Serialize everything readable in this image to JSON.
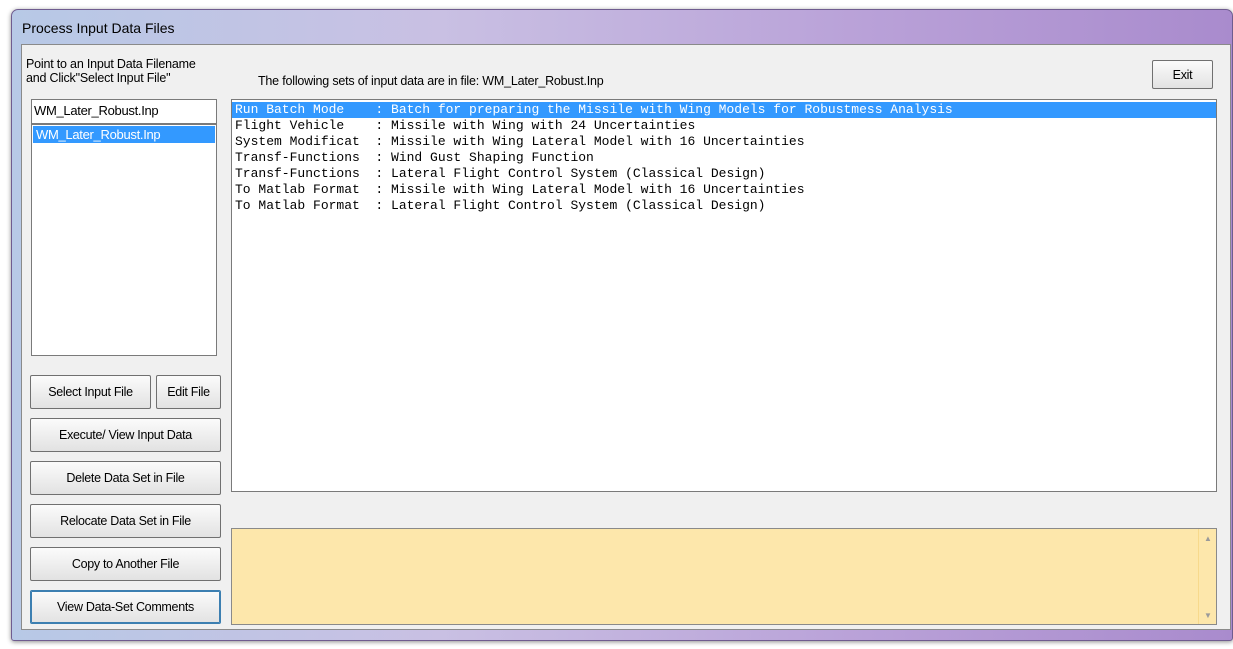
{
  "window": {
    "title": "Process Input Data Files"
  },
  "instructions": {
    "line1": "Point to an Input Data Filename",
    "line2": "and Click\"Select Input File\""
  },
  "file_header": {
    "text": "The following sets of input data are in file: WM_Later_Robust.Inp"
  },
  "exit_label": "Exit",
  "filename_field": {
    "value": "WM_Later_Robust.Inp"
  },
  "file_list": [
    "WM_Later_Robust.Inp"
  ],
  "datasets": [
    {
      "text": "Run Batch Mode    : Batch for preparing the Missile with Wing Models for Robustmess Analysis",
      "selected": true
    },
    {
      "text": "Flight Vehicle    : Missile with Wing with 24 Uncertainties",
      "selected": false
    },
    {
      "text": "System Modificat  : Missile with Wing Lateral Model with 16 Uncertainties",
      "selected": false
    },
    {
      "text": "Transf-Functions  : Wind Gust Shaping Function",
      "selected": false
    },
    {
      "text": "Transf-Functions  : Lateral Flight Control System (Classical Design)",
      "selected": false
    },
    {
      "text": "To Matlab Format  : Missile with Wing Lateral Model with 16 Uncertainties",
      "selected": false
    },
    {
      "text": "To Matlab Format  : Lateral Flight Control System (Classical Design)",
      "selected": false
    }
  ],
  "buttons": {
    "select_input_file": "Select Input File",
    "edit_file": "Edit File",
    "execute_view": "Execute/ View Input Data",
    "delete_data_set": "Delete Data Set in File",
    "relocate_data_set": "Relocate Data Set in File",
    "copy_to_another": "Copy to Another File",
    "view_comments": "View Data-Set Comments"
  },
  "comments": {
    "text": ""
  },
  "colors": {
    "selection": "#3399ff",
    "comments_bg": "#fde7ab",
    "dialog_bg": "#f0f0f0"
  }
}
